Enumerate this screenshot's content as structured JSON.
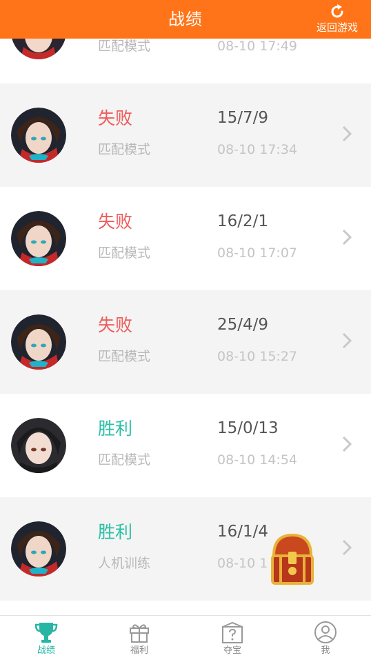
{
  "header": {
    "title": "战绩",
    "back_label": "返回游戏",
    "back_icon": "refresh-icon"
  },
  "top_partial": {
    "mode": "匹配模式",
    "time": "08-10 17:49"
  },
  "matches": [
    {
      "result": "失败",
      "outcome": "lose",
      "kda": "15/7/9",
      "mode": "匹配模式",
      "time": "08-10 17:34",
      "avatar": "red-scarf"
    },
    {
      "result": "失败",
      "outcome": "lose",
      "kda": "16/2/1",
      "mode": "匹配模式",
      "time": "08-10 17:07",
      "avatar": "red-scarf"
    },
    {
      "result": "失败",
      "outcome": "lose",
      "kda": "25/4/9",
      "mode": "匹配模式",
      "time": "08-10 15:27",
      "avatar": "red-scarf"
    },
    {
      "result": "胜利",
      "outcome": "win",
      "kda": "15/0/13",
      "mode": "匹配模式",
      "time": "08-10 14:54",
      "avatar": "dark-hair"
    },
    {
      "result": "胜利",
      "outcome": "win",
      "kda": "16/1/4",
      "mode": "人机训练",
      "time": "08-10 1",
      "avatar": "red-scarf"
    }
  ],
  "tabs": [
    {
      "label": "战绩",
      "icon": "trophy-icon",
      "active": true
    },
    {
      "label": "福利",
      "icon": "gift-icon",
      "active": false
    },
    {
      "label": "夺宝",
      "icon": "mystery-box-icon",
      "active": false
    },
    {
      "label": "我",
      "icon": "user-icon",
      "active": false
    }
  ],
  "colors": {
    "header": "#ff7418",
    "lose": "#ef5b5b",
    "win": "#28bfa6",
    "tab_active": "#27b6a3"
  }
}
